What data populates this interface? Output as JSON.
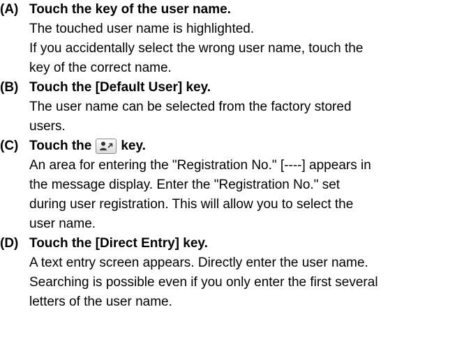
{
  "items": [
    {
      "marker": "(A)",
      "heading": "Touch the key of the user name.",
      "lines": [
        "The touched user name is highlighted.",
        "If you accidentally select the wrong user name, touch the",
        "key of the correct name."
      ]
    },
    {
      "marker": "(B)",
      "heading": "Touch the [Default User] key.",
      "lines": [
        "The user name can be selected from the factory stored",
        "users."
      ]
    },
    {
      "marker": "(C)",
      "heading_before": "Touch the",
      "heading_icon": "user-number-key-icon",
      "heading_after": "key.",
      "lines": [
        "An area for entering the \"Registration No.\" [----] appears in",
        "the message display. Enter the \"Registration No.\" set",
        "during user registration. This will allow you to select the",
        "user name."
      ]
    },
    {
      "marker": "(D)",
      "heading": "Touch the [Direct Entry] key.",
      "lines": [
        "A text entry screen appears. Directly enter the user name.",
        "Searching is possible even if you only enter the first several",
        "letters of the user name."
      ]
    }
  ]
}
